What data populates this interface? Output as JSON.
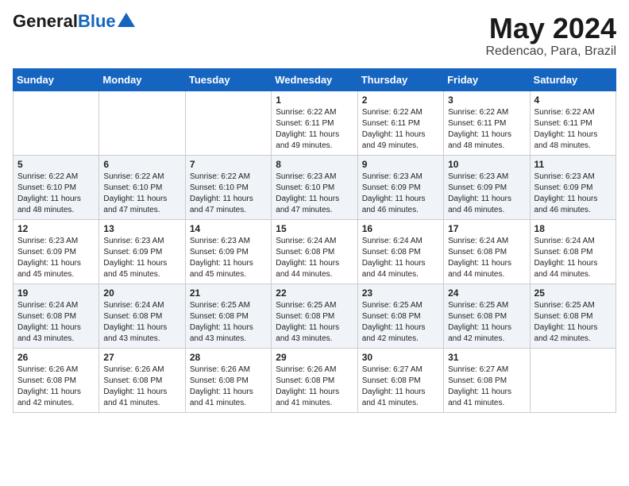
{
  "header": {
    "logo_general": "General",
    "logo_blue": "Blue",
    "month_year": "May 2024",
    "location": "Redencao, Para, Brazil"
  },
  "weekdays": [
    "Sunday",
    "Monday",
    "Tuesday",
    "Wednesday",
    "Thursday",
    "Friday",
    "Saturday"
  ],
  "weeks": [
    [
      {
        "day": "",
        "sunrise": "",
        "sunset": "",
        "daylight": ""
      },
      {
        "day": "",
        "sunrise": "",
        "sunset": "",
        "daylight": ""
      },
      {
        "day": "",
        "sunrise": "",
        "sunset": "",
        "daylight": ""
      },
      {
        "day": "1",
        "sunrise": "Sunrise: 6:22 AM",
        "sunset": "Sunset: 6:11 PM",
        "daylight": "Daylight: 11 hours and 49 minutes."
      },
      {
        "day": "2",
        "sunrise": "Sunrise: 6:22 AM",
        "sunset": "Sunset: 6:11 PM",
        "daylight": "Daylight: 11 hours and 49 minutes."
      },
      {
        "day": "3",
        "sunrise": "Sunrise: 6:22 AM",
        "sunset": "Sunset: 6:11 PM",
        "daylight": "Daylight: 11 hours and 48 minutes."
      },
      {
        "day": "4",
        "sunrise": "Sunrise: 6:22 AM",
        "sunset": "Sunset: 6:11 PM",
        "daylight": "Daylight: 11 hours and 48 minutes."
      }
    ],
    [
      {
        "day": "5",
        "sunrise": "Sunrise: 6:22 AM",
        "sunset": "Sunset: 6:10 PM",
        "daylight": "Daylight: 11 hours and 48 minutes."
      },
      {
        "day": "6",
        "sunrise": "Sunrise: 6:22 AM",
        "sunset": "Sunset: 6:10 PM",
        "daylight": "Daylight: 11 hours and 47 minutes."
      },
      {
        "day": "7",
        "sunrise": "Sunrise: 6:22 AM",
        "sunset": "Sunset: 6:10 PM",
        "daylight": "Daylight: 11 hours and 47 minutes."
      },
      {
        "day": "8",
        "sunrise": "Sunrise: 6:23 AM",
        "sunset": "Sunset: 6:10 PM",
        "daylight": "Daylight: 11 hours and 47 minutes."
      },
      {
        "day": "9",
        "sunrise": "Sunrise: 6:23 AM",
        "sunset": "Sunset: 6:09 PM",
        "daylight": "Daylight: 11 hours and 46 minutes."
      },
      {
        "day": "10",
        "sunrise": "Sunrise: 6:23 AM",
        "sunset": "Sunset: 6:09 PM",
        "daylight": "Daylight: 11 hours and 46 minutes."
      },
      {
        "day": "11",
        "sunrise": "Sunrise: 6:23 AM",
        "sunset": "Sunset: 6:09 PM",
        "daylight": "Daylight: 11 hours and 46 minutes."
      }
    ],
    [
      {
        "day": "12",
        "sunrise": "Sunrise: 6:23 AM",
        "sunset": "Sunset: 6:09 PM",
        "daylight": "Daylight: 11 hours and 45 minutes."
      },
      {
        "day": "13",
        "sunrise": "Sunrise: 6:23 AM",
        "sunset": "Sunset: 6:09 PM",
        "daylight": "Daylight: 11 hours and 45 minutes."
      },
      {
        "day": "14",
        "sunrise": "Sunrise: 6:23 AM",
        "sunset": "Sunset: 6:09 PM",
        "daylight": "Daylight: 11 hours and 45 minutes."
      },
      {
        "day": "15",
        "sunrise": "Sunrise: 6:24 AM",
        "sunset": "Sunset: 6:08 PM",
        "daylight": "Daylight: 11 hours and 44 minutes."
      },
      {
        "day": "16",
        "sunrise": "Sunrise: 6:24 AM",
        "sunset": "Sunset: 6:08 PM",
        "daylight": "Daylight: 11 hours and 44 minutes."
      },
      {
        "day": "17",
        "sunrise": "Sunrise: 6:24 AM",
        "sunset": "Sunset: 6:08 PM",
        "daylight": "Daylight: 11 hours and 44 minutes."
      },
      {
        "day": "18",
        "sunrise": "Sunrise: 6:24 AM",
        "sunset": "Sunset: 6:08 PM",
        "daylight": "Daylight: 11 hours and 44 minutes."
      }
    ],
    [
      {
        "day": "19",
        "sunrise": "Sunrise: 6:24 AM",
        "sunset": "Sunset: 6:08 PM",
        "daylight": "Daylight: 11 hours and 43 minutes."
      },
      {
        "day": "20",
        "sunrise": "Sunrise: 6:24 AM",
        "sunset": "Sunset: 6:08 PM",
        "daylight": "Daylight: 11 hours and 43 minutes."
      },
      {
        "day": "21",
        "sunrise": "Sunrise: 6:25 AM",
        "sunset": "Sunset: 6:08 PM",
        "daylight": "Daylight: 11 hours and 43 minutes."
      },
      {
        "day": "22",
        "sunrise": "Sunrise: 6:25 AM",
        "sunset": "Sunset: 6:08 PM",
        "daylight": "Daylight: 11 hours and 43 minutes."
      },
      {
        "day": "23",
        "sunrise": "Sunrise: 6:25 AM",
        "sunset": "Sunset: 6:08 PM",
        "daylight": "Daylight: 11 hours and 42 minutes."
      },
      {
        "day": "24",
        "sunrise": "Sunrise: 6:25 AM",
        "sunset": "Sunset: 6:08 PM",
        "daylight": "Daylight: 11 hours and 42 minutes."
      },
      {
        "day": "25",
        "sunrise": "Sunrise: 6:25 AM",
        "sunset": "Sunset: 6:08 PM",
        "daylight": "Daylight: 11 hours and 42 minutes."
      }
    ],
    [
      {
        "day": "26",
        "sunrise": "Sunrise: 6:26 AM",
        "sunset": "Sunset: 6:08 PM",
        "daylight": "Daylight: 11 hours and 42 minutes."
      },
      {
        "day": "27",
        "sunrise": "Sunrise: 6:26 AM",
        "sunset": "Sunset: 6:08 PM",
        "daylight": "Daylight: 11 hours and 41 minutes."
      },
      {
        "day": "28",
        "sunrise": "Sunrise: 6:26 AM",
        "sunset": "Sunset: 6:08 PM",
        "daylight": "Daylight: 11 hours and 41 minutes."
      },
      {
        "day": "29",
        "sunrise": "Sunrise: 6:26 AM",
        "sunset": "Sunset: 6:08 PM",
        "daylight": "Daylight: 11 hours and 41 minutes."
      },
      {
        "day": "30",
        "sunrise": "Sunrise: 6:27 AM",
        "sunset": "Sunset: 6:08 PM",
        "daylight": "Daylight: 11 hours and 41 minutes."
      },
      {
        "day": "31",
        "sunrise": "Sunrise: 6:27 AM",
        "sunset": "Sunset: 6:08 PM",
        "daylight": "Daylight: 11 hours and 41 minutes."
      },
      {
        "day": "",
        "sunrise": "",
        "sunset": "",
        "daylight": ""
      }
    ]
  ]
}
